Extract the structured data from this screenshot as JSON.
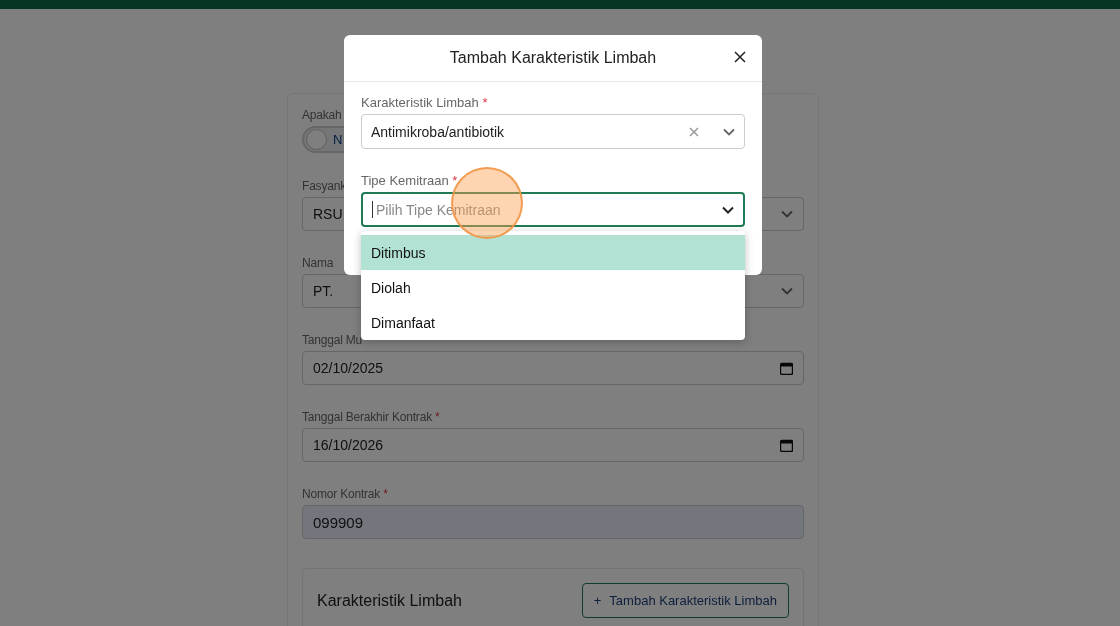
{
  "background_form": {
    "fields": [
      {
        "kind": "toggle",
        "label": "Apakah",
        "value": "N",
        "on": false
      },
      {
        "kind": "select",
        "label": "Fasyank",
        "value": "RSU"
      },
      {
        "kind": "select",
        "label": "Nama",
        "value": "PT."
      },
      {
        "kind": "date",
        "label": "Tanggal Mu",
        "value": "02/10/2025"
      },
      {
        "kind": "date",
        "label": "Tanggal Berakhir Kontrak",
        "required_mark": "*",
        "value": "16/10/2026"
      },
      {
        "kind": "text",
        "label": "Nomor Kontrak",
        "required_mark": "*",
        "value": "099909"
      }
    ],
    "section": {
      "title": "Karakteristik Limbah",
      "button_icon": "+",
      "button": "Tambah Karakteristik Limbah"
    }
  },
  "modal": {
    "title": "Tambah Karakteristik Limbah",
    "fields": [
      {
        "label": "Karakteristik Limbah",
        "required_mark": "*",
        "value": "Antimikroba/antibiotik",
        "expanded": false
      },
      {
        "label": "Tipe Kemitraan",
        "required_mark": "*",
        "placeholder": "Pilih Tipe Kemitraan",
        "expanded": true,
        "options": [
          {
            "label": "Ditimbus",
            "selected": true
          },
          {
            "label": "Diolah",
            "selected": false
          },
          {
            "label": "Dimanfaat",
            "selected": false
          }
        ]
      }
    ]
  }
}
